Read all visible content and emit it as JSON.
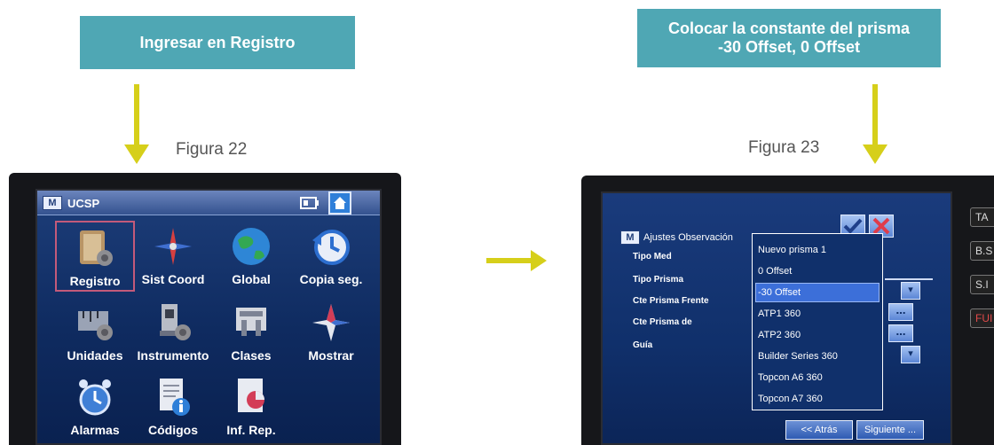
{
  "left": {
    "callout": "Ingresar en Registro",
    "caption": "Figura 22",
    "screen": {
      "title": "UCSP",
      "apps": [
        {
          "label": "Registro",
          "icon": "registro-icon"
        },
        {
          "label": "Sist Coord",
          "icon": "compass-icon"
        },
        {
          "label": "Global",
          "icon": "globe-icon"
        },
        {
          "label": "Copia seg.",
          "icon": "backup-clock-icon"
        },
        {
          "label": "Unidades",
          "icon": "units-ruler-icon"
        },
        {
          "label": "Instrumento",
          "icon": "instrument-icon"
        },
        {
          "label": "Clases",
          "icon": "classes-icon"
        },
        {
          "label": "Mostrar",
          "icon": "display-star-icon"
        },
        {
          "label": "Alarmas",
          "icon": "alarm-clock-icon"
        },
        {
          "label": "Códigos",
          "icon": "codes-document-icon"
        },
        {
          "label": "Inf. Rep.",
          "icon": "report-icon"
        }
      ]
    }
  },
  "right": {
    "callout_line1": "Colocar la constante del prisma",
    "callout_line2": "-30 Offset, 0 Offset",
    "caption": "Figura 23",
    "screen": {
      "title": "Ajustes Observación",
      "labels": [
        "Tipo Med",
        "Tipo Prisma",
        "Cte Prisma Frente",
        "Cte Prisma de",
        "Guía"
      ],
      "options": [
        "Nuevo prisma 1",
        "0 Offset",
        "-30 Offset",
        "ATP1 360",
        "ATP2 360",
        "Builder Series 360",
        "Topcon A6 360",
        "Topcon A7 360"
      ],
      "selected": "-30 Offset",
      "back_button": "<< Atrás",
      "next_button": "Siguiente ..."
    },
    "side_keys": [
      "TA",
      "B.S",
      "S.I",
      "FUI"
    ]
  },
  "colors": {
    "callout_bg": "#4fa7b4",
    "arrow": "#d6cf1a"
  }
}
